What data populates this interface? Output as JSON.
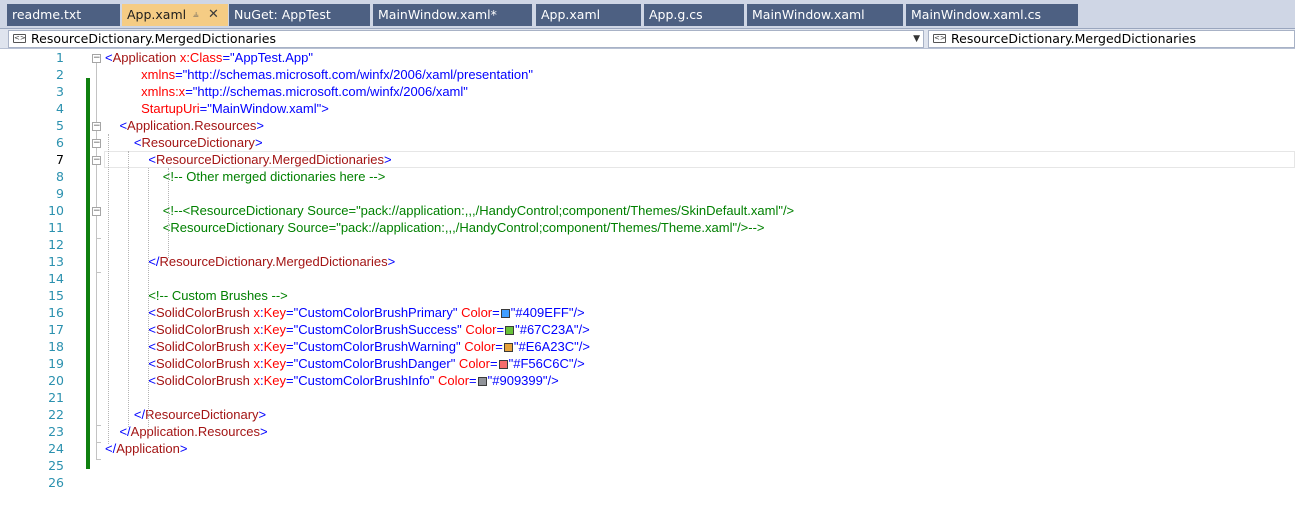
{
  "tabs": [
    {
      "label": "readme.txt",
      "active": false
    },
    {
      "label": "App.xaml",
      "active": true
    },
    {
      "label": "NuGet: AppTest",
      "active": false
    },
    {
      "label": "MainWindow.xaml*",
      "active": false
    },
    {
      "label": "App.xaml",
      "active": false
    },
    {
      "label": "App.g.cs",
      "active": false
    },
    {
      "label": "MainWindow.xaml",
      "active": false
    },
    {
      "label": "MainWindow.xaml.cs",
      "active": false
    }
  ],
  "tab_icons": {
    "pin": "pin-icon",
    "close": "close-icon"
  },
  "navbar": {
    "left_value": "ResourceDictionary.MergedDictionaries",
    "right_value": "ResourceDictionary.MergedDictionaries",
    "icon": "element-icon"
  },
  "current_line": 7,
  "colors": {
    "tag": "#a31515",
    "bracket": "#0000ff",
    "attribute": "#ff0000",
    "value": "#0000ff",
    "comment": "#008000",
    "line_number": "#2b91af",
    "change_bar": "#108010"
  },
  "lines": [
    {
      "n": "1",
      "tokens": [
        [
          "br",
          "<"
        ],
        [
          "tag",
          "Application"
        ],
        [
          "attr",
          " x:Class"
        ],
        [
          "br",
          "="
        ],
        [
          "val",
          "\"AppTest.App\""
        ]
      ]
    },
    {
      "n": "2",
      "tokens": [
        [
          "attr",
          "          xmlns"
        ],
        [
          "br",
          "="
        ],
        [
          "val",
          "\"http://schemas.microsoft.com/winfx/2006/xaml/presentation\""
        ]
      ]
    },
    {
      "n": "3",
      "tokens": [
        [
          "attr",
          "          xmlns:x"
        ],
        [
          "br",
          "="
        ],
        [
          "val",
          "\"http://schemas.microsoft.com/winfx/2006/xaml\""
        ]
      ]
    },
    {
      "n": "4",
      "tokens": [
        [
          "attr",
          "          StartupUri"
        ],
        [
          "br",
          "="
        ],
        [
          "val",
          "\"MainWindow.xaml\""
        ],
        [
          "br",
          ">"
        ]
      ]
    },
    {
      "n": "5",
      "tokens": [
        [
          "br",
          "    <"
        ],
        [
          "tag",
          "Application.Resources"
        ],
        [
          "br",
          ">"
        ]
      ]
    },
    {
      "n": "6",
      "tokens": [
        [
          "br",
          "        <"
        ],
        [
          "tag",
          "ResourceDictionary"
        ],
        [
          "br",
          ">"
        ]
      ]
    },
    {
      "n": "7",
      "tokens": [
        [
          "br",
          "            <"
        ],
        [
          "tag",
          "ResourceDictionary.MergedDictionaries"
        ],
        [
          "br",
          ">"
        ]
      ]
    },
    {
      "n": "8",
      "tokens": [
        [
          "cmt",
          "                <!-- Other merged dictionaries here -->"
        ]
      ]
    },
    {
      "n": "9",
      "tokens": []
    },
    {
      "n": "10",
      "tokens": [
        [
          "cmt",
          "                <!--<ResourceDictionary Source=\"pack://application:,,,/HandyControl;component/Themes/SkinDefault.xaml\"/>"
        ]
      ]
    },
    {
      "n": "11",
      "tokens": [
        [
          "cmt",
          "                <ResourceDictionary Source=\"pack://application:,,,/HandyControl;component/Themes/Theme.xaml\"/>-->"
        ]
      ]
    },
    {
      "n": "12",
      "tokens": []
    },
    {
      "n": "13",
      "tokens": [
        [
          "br",
          "            </"
        ],
        [
          "tag",
          "ResourceDictionary.MergedDictionaries"
        ],
        [
          "br",
          ">"
        ]
      ]
    },
    {
      "n": "14",
      "tokens": []
    },
    {
      "n": "15",
      "tokens": [
        [
          "cmt",
          "            <!-- Custom Brushes -->"
        ]
      ]
    },
    {
      "n": "16",
      "tokens": [
        [
          "br",
          "            <"
        ],
        [
          "tag",
          "SolidColorBrush"
        ],
        [
          "attr",
          " x"
        ],
        [
          "br",
          ":"
        ],
        [
          "attr",
          "Key"
        ],
        [
          "br",
          "="
        ],
        [
          "val",
          "\"CustomColorBrushPrimary\""
        ],
        [
          "attr",
          " Color"
        ],
        [
          "br",
          "="
        ],
        [
          "sw",
          "#409EFF"
        ],
        [
          "val",
          "\"#409EFF\""
        ],
        [
          "br",
          "/>"
        ]
      ]
    },
    {
      "n": "17",
      "tokens": [
        [
          "br",
          "            <"
        ],
        [
          "tag",
          "SolidColorBrush"
        ],
        [
          "attr",
          " x"
        ],
        [
          "br",
          ":"
        ],
        [
          "attr",
          "Key"
        ],
        [
          "br",
          "="
        ],
        [
          "val",
          "\"CustomColorBrushSuccess\""
        ],
        [
          "attr",
          " Color"
        ],
        [
          "br",
          "="
        ],
        [
          "sw",
          "#67C23A"
        ],
        [
          "val",
          "\"#67C23A\""
        ],
        [
          "br",
          "/>"
        ]
      ]
    },
    {
      "n": "18",
      "tokens": [
        [
          "br",
          "            <"
        ],
        [
          "tag",
          "SolidColorBrush"
        ],
        [
          "attr",
          " x"
        ],
        [
          "br",
          ":"
        ],
        [
          "attr",
          "Key"
        ],
        [
          "br",
          "="
        ],
        [
          "val",
          "\"CustomColorBrushWarning\""
        ],
        [
          "attr",
          " Color"
        ],
        [
          "br",
          "="
        ],
        [
          "sw",
          "#E6A23C"
        ],
        [
          "val",
          "\"#E6A23C\""
        ],
        [
          "br",
          "/>"
        ]
      ]
    },
    {
      "n": "19",
      "tokens": [
        [
          "br",
          "            <"
        ],
        [
          "tag",
          "SolidColorBrush"
        ],
        [
          "attr",
          " x"
        ],
        [
          "br",
          ":"
        ],
        [
          "attr",
          "Key"
        ],
        [
          "br",
          "="
        ],
        [
          "val",
          "\"CustomColorBrushDanger\""
        ],
        [
          "attr",
          " Color"
        ],
        [
          "br",
          "="
        ],
        [
          "sw",
          "#F56C6C"
        ],
        [
          "val",
          "\"#F56C6C\""
        ],
        [
          "br",
          "/>"
        ]
      ]
    },
    {
      "n": "20",
      "tokens": [
        [
          "br",
          "            <"
        ],
        [
          "tag",
          "SolidColorBrush"
        ],
        [
          "attr",
          " x"
        ],
        [
          "br",
          ":"
        ],
        [
          "attr",
          "Key"
        ],
        [
          "br",
          "="
        ],
        [
          "val",
          "\"CustomColorBrushInfo\""
        ],
        [
          "attr",
          " Color"
        ],
        [
          "br",
          "="
        ],
        [
          "sw",
          "#909399"
        ],
        [
          "val",
          "\"#909399\""
        ],
        [
          "br",
          "/>"
        ]
      ]
    },
    {
      "n": "21",
      "tokens": []
    },
    {
      "n": "22",
      "tokens": [
        [
          "br",
          "        </"
        ],
        [
          "tag",
          "ResourceDictionary"
        ],
        [
          "br",
          ">"
        ]
      ]
    },
    {
      "n": "23",
      "tokens": [
        [
          "br",
          "    </"
        ],
        [
          "tag",
          "Application.Resources"
        ],
        [
          "br",
          ">"
        ]
      ]
    },
    {
      "n": "24",
      "tokens": [
        [
          "br",
          "</"
        ],
        [
          "tag",
          "Application"
        ],
        [
          "br",
          ">"
        ]
      ]
    },
    {
      "n": "25",
      "tokens": []
    },
    {
      "n": "26",
      "tokens": []
    }
  ]
}
